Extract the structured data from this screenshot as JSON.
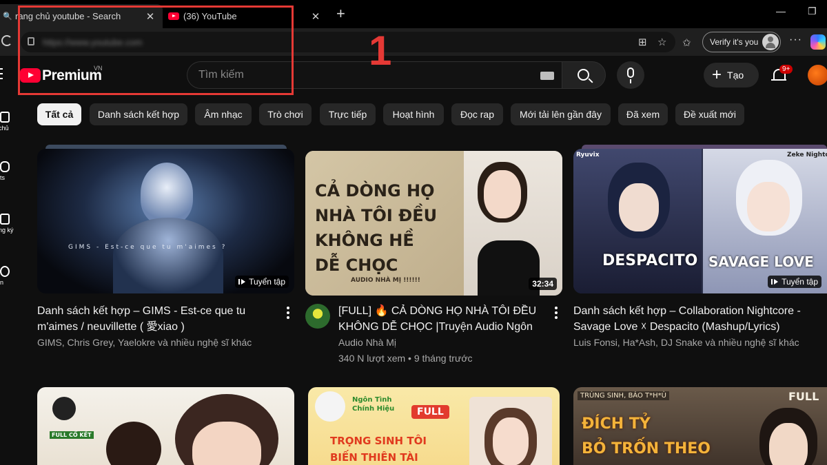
{
  "browser": {
    "tabs": [
      {
        "title": "rang chủ youtube - Search",
        "close": "✕"
      },
      {
        "title": "(36) YouTube",
        "close": "✕"
      }
    ],
    "new_tab": "+",
    "window": {
      "minimize": "—",
      "restore": "❐"
    },
    "address_url": "https://www.youtube.com",
    "verify_label": "Verify it's you",
    "more": "···"
  },
  "youtube": {
    "logo_text": "Premium",
    "country_code": "VN",
    "search_placeholder": "Tìm kiếm",
    "create_label": "Tạo",
    "notification_badge": "9+"
  },
  "annotation": {
    "number": "1"
  },
  "rail": [
    {
      "label": "chủ"
    },
    {
      "label": "ts"
    },
    {
      "label": "ng ký"
    },
    {
      "label": "n"
    }
  ],
  "chips": [
    "Tất cả",
    "Danh sách kết hợp",
    "Âm nhạc",
    "Trò chơi",
    "Trực tiếp",
    "Hoạt hình",
    "Đọc rap",
    "Mới tải lên gần đây",
    "Đã xem",
    "Đề xuất mới"
  ],
  "videos": [
    {
      "title": "Danh sách kết hợp – GIMS - Est-ce que tu m'aimes / neuvillette ( 愛xiao )",
      "meta1": "GIMS, Chris Grey, Yaelokre và nhiều nghệ sĩ khác",
      "overlay": "Tuyển tập",
      "thumb_text": "GIMS - Est-ce que tu m'aimes ?"
    },
    {
      "title": "[FULL] 🔥 CẢ DÒNG HỌ NHÀ TÔI ĐỀU KHÔNG DỄ CHỌC |Truyện Audio Ngôn …",
      "channel": "Audio Nhà Mị",
      "meta2": "340 N lượt xem • 9 tháng trước",
      "overlay": "32:34",
      "thumb_text": "CẢ DÒNG HỌ\nNHÀ TÔI ĐỀU\nKHÔNG HỀ\nDỄ CHỌC",
      "thumb_sub": "AUDIO NHÀ MỊ !!!!!!"
    },
    {
      "title": "Danh sách kết hợp – Collaboration Nightcore - Savage Love ☓ Despacito (Mashup/Lyrics)",
      "meta1": "Luis Fonsi, Ha*Ash, DJ Snake và nhiều nghệ sĩ khác",
      "overlay": "Tuyển tập",
      "thumb_left": "DESPACITO",
      "thumb_right": "SAVAGE LOVE",
      "tag_left": "Ryuvix",
      "tag_right": "Zeke Nightcore"
    },
    {
      "thumb_text": "FULL CỔ KẾT"
    },
    {
      "thumb_text": "TRỌNG SINH TÔI\nBIẾN THIÊN TÀI",
      "thumb_tag": "Ngôn Tình\nChính Hiệu",
      "thumb_badge": "FULL"
    },
    {
      "thumb_text": "ĐÍCH TỶ\nBỎ TRỐN THEO",
      "thumb_tag": "TRÙNG SINH, BÁO T*H*Ù",
      "thumb_badge": "FULL"
    }
  ],
  "colors": {
    "bg": "#0f0f0f",
    "accent": "#ff0033",
    "annotation": "#e53935"
  }
}
